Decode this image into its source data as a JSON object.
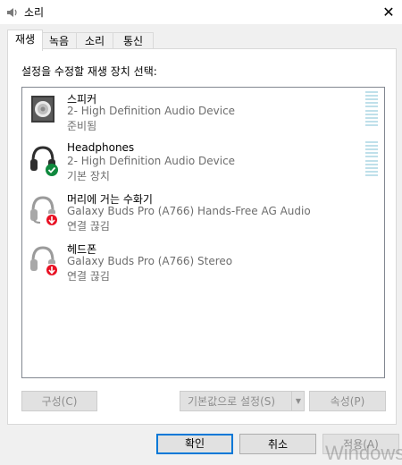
{
  "window": {
    "title": "소리",
    "close_symbol": "✕"
  },
  "tabs": [
    {
      "label": "재생",
      "active": true
    },
    {
      "label": "녹음",
      "active": false
    },
    {
      "label": "소리",
      "active": false
    },
    {
      "label": "통신",
      "active": false
    }
  ],
  "panel": {
    "instruction": "설정을 수정할 재생 장치 선택:"
  },
  "devices": [
    {
      "name": "스피커",
      "description": "2- High Definition Audio Device",
      "status": "준비됨",
      "icon": "speaker-icon",
      "badge": "none",
      "has_meter": true
    },
    {
      "name": "Headphones",
      "description": "2- High Definition Audio Device",
      "status": "기본 장치",
      "icon": "headphones-icon",
      "badge": "default-check",
      "has_meter": true
    },
    {
      "name": "머리에 거는 수화기",
      "description": "Galaxy Buds Pro (A766) Hands-Free AG Audio",
      "status": "연결 끊김",
      "icon": "headset-icon",
      "badge": "disconnected-arrow",
      "has_meter": false
    },
    {
      "name": "헤드폰",
      "description": "Galaxy Buds Pro (A766) Stereo",
      "status": "연결 끊김",
      "icon": "headphones-icon",
      "badge": "disconnected-arrow",
      "has_meter": false
    }
  ],
  "panel_buttons": {
    "configure": "구성(C)",
    "set_default": "기본값으로 설정(S)",
    "properties": "속성(P)"
  },
  "dialog_buttons": {
    "ok": "확인",
    "cancel": "취소",
    "apply": "적용(A)"
  },
  "watermark": "Windows",
  "colors": {
    "accent": "#0078d7",
    "check_green": "#10893e",
    "disconnect_red": "#e81123",
    "meter": "#bfe0ea"
  }
}
